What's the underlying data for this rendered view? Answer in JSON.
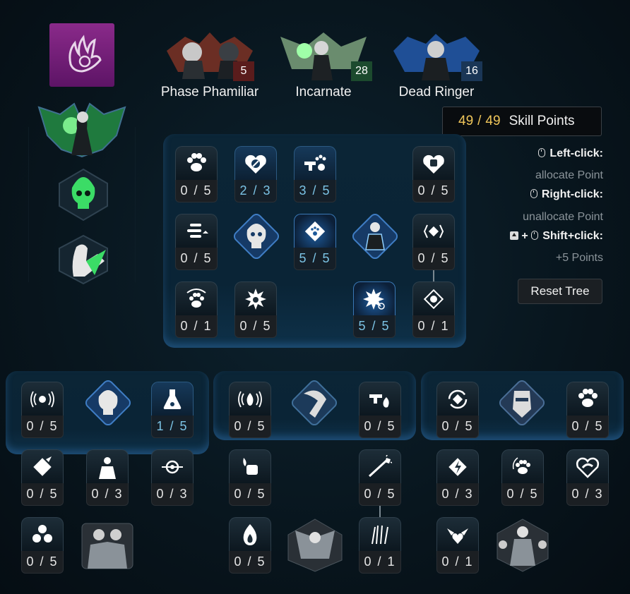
{
  "header": {
    "classes": [
      {
        "name": "Phase Phamiliar",
        "level": "5",
        "badge_color": "#5a1c1c"
      },
      {
        "name": "Incarnate",
        "level": "28",
        "badge_color": "#1c4a2e"
      },
      {
        "name": "Dead Ringer",
        "level": "16",
        "badge_color": "#1a3656"
      }
    ]
  },
  "skill_points": {
    "current": "49",
    "separator": "/",
    "max": "49",
    "label": "Skill Points"
  },
  "help": {
    "left_key": "Left-click:",
    "left_desc": "allocate Point",
    "right_key": "Right-click:",
    "right_desc": "unallocate Point",
    "shift_key": "Shift+click:",
    "shift_plus": "+",
    "shift_desc": "+5 Points"
  },
  "reset_label": "Reset Tree",
  "main_tree": {
    "row1": [
      {
        "value": "0 / 5",
        "icon": "paw-icon"
      },
      {
        "value": "2 / 3",
        "icon": "shield-heart-icon"
      },
      {
        "value": "3 / 5",
        "icon": "gun-paw-icon"
      },
      {
        "value": "0 / 5",
        "icon": "fist-heart-icon"
      }
    ],
    "row2": [
      {
        "value": "0 / 5",
        "icon": "bullets-icon"
      },
      {
        "value": "5 / 5",
        "icon": "diamond-paw-icon"
      },
      {
        "value": "0 / 5",
        "icon": "bracket-diamond-icon"
      }
    ],
    "row3": [
      {
        "value": "0 / 1",
        "icon": "paw-target-icon"
      },
      {
        "value": "0 / 5",
        "icon": "paw-burst-icon"
      },
      {
        "value": "5 / 5",
        "icon": "burst-gear-icon"
      },
      {
        "value": "0 / 1",
        "icon": "target-diamond-icon"
      }
    ]
  },
  "sub_trees": [
    {
      "row1": [
        {
          "value": "0 / 5",
          "icon": "biohazard-signal-icon"
        },
        {
          "value": "1 / 5",
          "icon": "flask-icon"
        }
      ],
      "row2": [
        {
          "value": "0 / 5",
          "icon": "diamond-claw-icon"
        },
        {
          "value": "0 / 3",
          "icon": "silhouette-icon"
        },
        {
          "value": "0 / 3",
          "icon": "crosshair-icon"
        }
      ],
      "row3": [
        {
          "value": "0 / 5",
          "icon": "biohazard-icon"
        }
      ]
    },
    {
      "row1": [
        {
          "value": "0 / 5",
          "icon": "fire-signal-icon"
        },
        {
          "value": "0 / 5",
          "icon": "gun-fire-icon"
        }
      ],
      "row2": [
        {
          "value": "0 / 5",
          "icon": "burning-fist-icon"
        },
        {
          "value": "0 / 5",
          "icon": "arrow-burst-icon"
        }
      ],
      "row3": [
        {
          "value": "0 / 5",
          "icon": "flame-icon"
        },
        {
          "value": "0 / 1",
          "icon": "claws-icon"
        }
      ]
    },
    {
      "row1": [
        {
          "value": "0 / 5",
          "icon": "cycle-diamond-icon"
        },
        {
          "value": "0 / 5",
          "icon": "paw-splash-icon"
        }
      ],
      "row2": [
        {
          "value": "0 / 3",
          "icon": "lightning-diamond-icon"
        },
        {
          "value": "0 / 5",
          "icon": "paw-drops-icon"
        },
        {
          "value": "0 / 3",
          "icon": "heart-swirl-icon"
        }
      ],
      "row3": [
        {
          "value": "0 / 1",
          "icon": "winged-heart-icon"
        }
      ]
    }
  ]
}
